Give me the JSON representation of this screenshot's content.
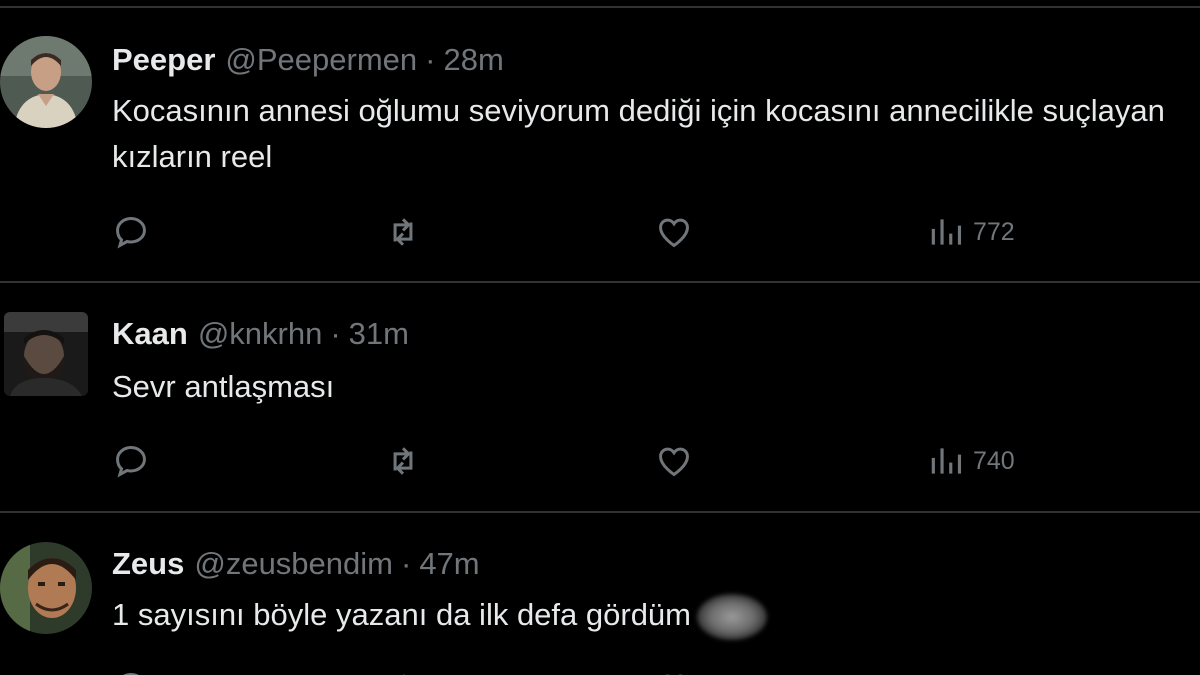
{
  "tweets": [
    {
      "name": "Peeper",
      "handle": "@Peepermen",
      "separator": "·",
      "time": "28m",
      "text": "Kocasının annesi oğlumu seviyorum dediği için kocasını annecilikle suçlayan kızların reel",
      "views": "772",
      "avatar": "man-portrait-avatar"
    },
    {
      "name": "Kaan",
      "handle": "@knkrhn",
      "separator": "·",
      "time": "31m",
      "text": "Sevr antlaşması",
      "views": "740",
      "avatar": "bearded-man-avatar"
    },
    {
      "name": "Zeus",
      "handle": "@zeusbendim",
      "separator": "·",
      "time": "47m",
      "text": "1 sayısını böyle yazanı da ilk defa gördüm",
      "views": "",
      "avatar": "smiling-man-avatar"
    }
  ],
  "icons": {
    "reply": "reply-icon",
    "retweet": "retweet-icon",
    "like": "heart-icon",
    "views": "views-chart-icon"
  },
  "colors": {
    "background": "#000000",
    "text": "#e7e9ea",
    "muted": "#71767b",
    "divider": "#2f3336"
  }
}
